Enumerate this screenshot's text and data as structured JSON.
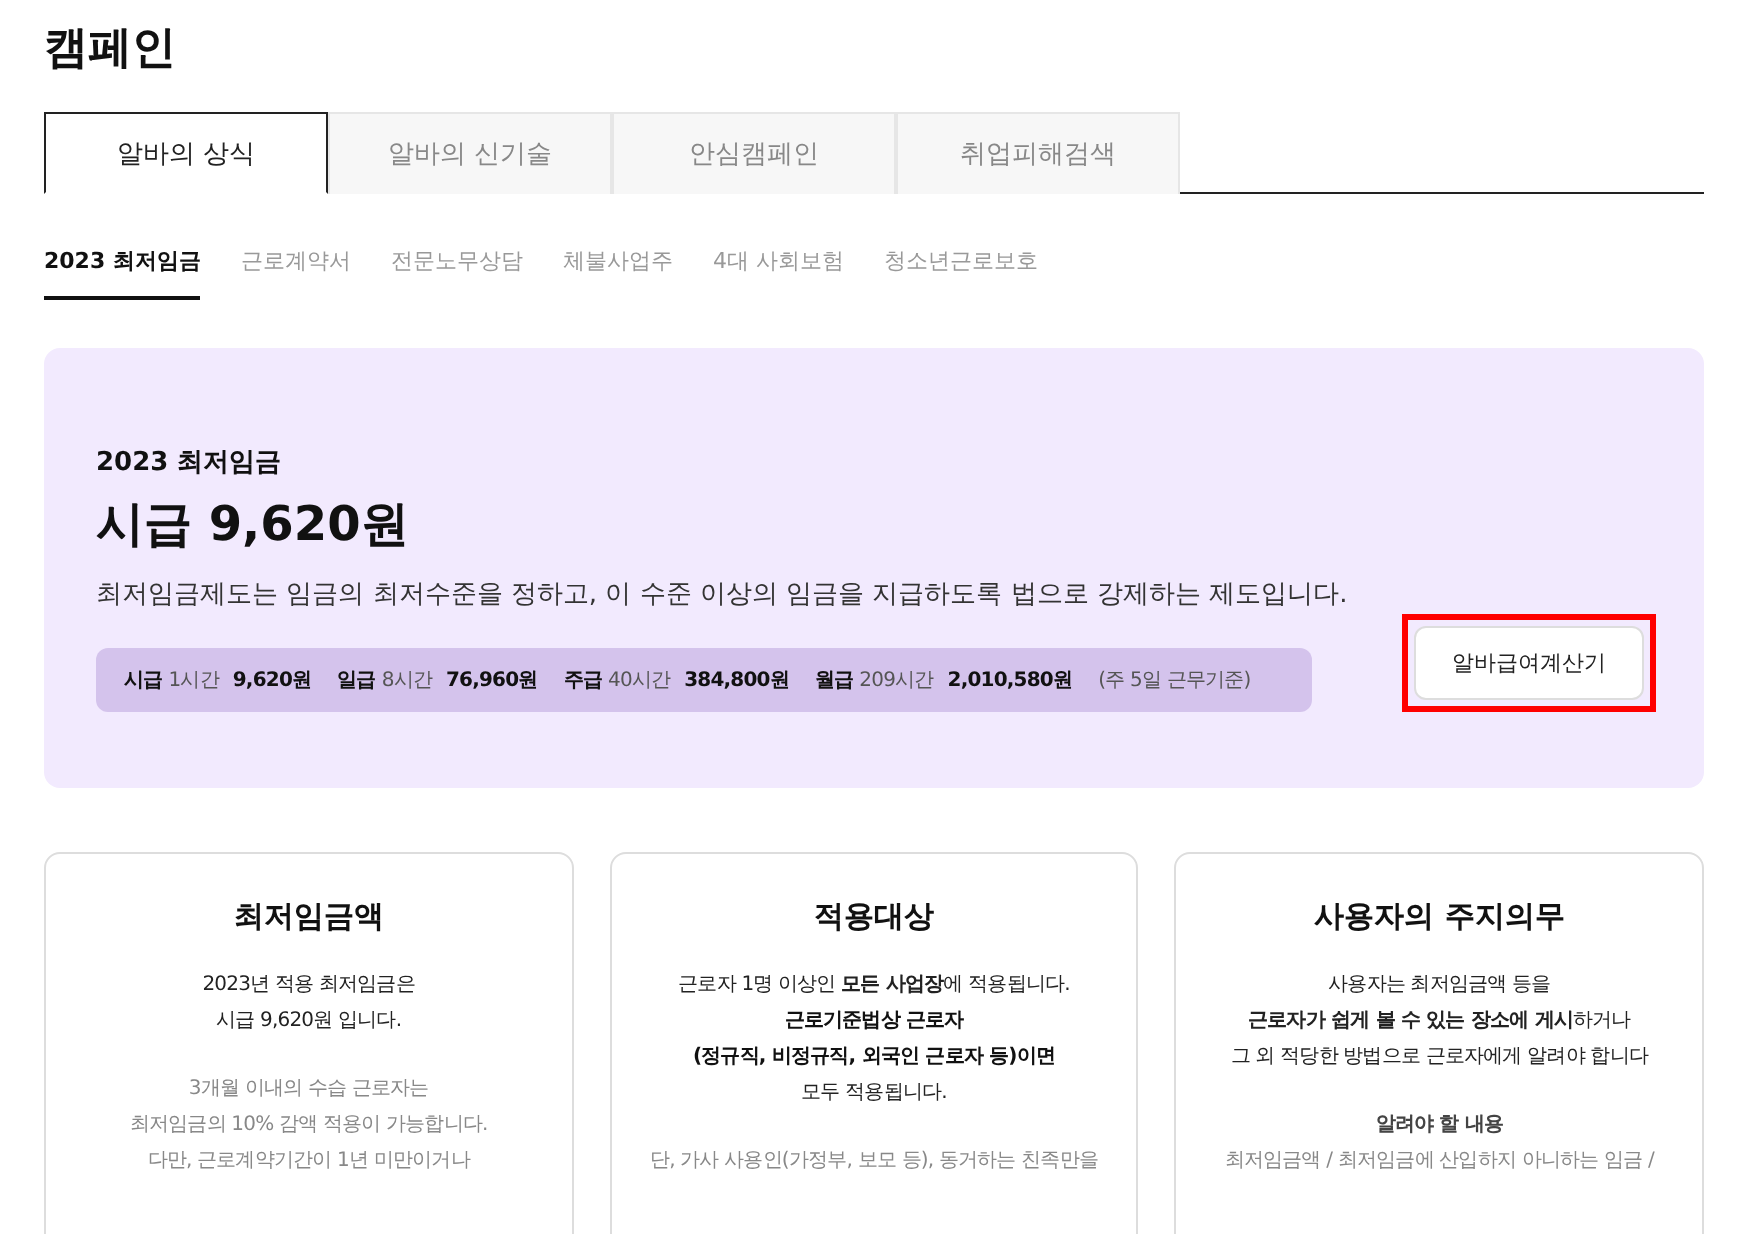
{
  "page_title": "캠페인",
  "tabs": [
    {
      "label": "알바의 상식",
      "selected": true
    },
    {
      "label": "알바의 신기술",
      "selected": false
    },
    {
      "label": "안심캠페인",
      "selected": false
    },
    {
      "label": "취업피해검색",
      "selected": false
    }
  ],
  "subnav": [
    {
      "label": "2023 최저임금",
      "selected": true
    },
    {
      "label": "근로계약서",
      "selected": false
    },
    {
      "label": "전문노무상담",
      "selected": false
    },
    {
      "label": "체불사업주",
      "selected": false
    },
    {
      "label": "4대 사회보험",
      "selected": false
    },
    {
      "label": "청소년근로보호",
      "selected": false
    }
  ],
  "hero": {
    "eyebrow": "2023 최저임금",
    "headline": "시급 9,620원",
    "description": "최저임금제도는 임금의 최저수준을 정하고, 이 수준 이상의 임금을 지급하도록 법으로 강제하는 제도입니다.",
    "wages": [
      {
        "label": "시급",
        "hours": "1시간",
        "amount": "9,620원"
      },
      {
        "label": "일급",
        "hours": "8시간",
        "amount": "76,960원"
      },
      {
        "label": "주급",
        "hours": "40시간",
        "amount": "384,800원"
      },
      {
        "label": "월급",
        "hours": "209시간",
        "amount": "2,010,580원"
      }
    ],
    "note": "(주 5일 근무기준)",
    "button": {
      "label": "알바급여계산기",
      "highlighted": true
    }
  },
  "cards": [
    {
      "title": "최저임금액",
      "blocks": [
        {
          "kind": "normal",
          "lines": [
            "2023년 적용 최저임금은",
            "시급 9,620원 입니다."
          ]
        },
        {
          "kind": "muted",
          "lines": [
            "3개월 이내의 수습 근로자는",
            "최저임금의 10% 감액 적용이 가능합니다.",
            "다만, 근로계약기간이 1년 미만이거나"
          ]
        }
      ]
    },
    {
      "title": "적용대상",
      "blocks": [
        {
          "kind": "normal",
          "lines": [
            "근로자 1명 이상인 **모든 사업장**에 적용됩니다."
          ]
        },
        {
          "kind": "bold",
          "lines": [
            "근로기준법상 근로자",
            "(정규직, 비정규직, 외국인 근로자 등)이면"
          ]
        },
        {
          "kind": "normal",
          "lines": [
            "모두 적용됩니다."
          ]
        },
        {
          "kind": "gap"
        },
        {
          "kind": "muted",
          "lines": [
            "단, 가사 사용인(가정부, 보모 등), 동거하는 친족만을"
          ]
        }
      ]
    },
    {
      "title": "사용자의 주지의무",
      "blocks": [
        {
          "kind": "normal",
          "lines": [
            "사용자는 최저임금액 등을",
            "**근로자가 쉽게 볼 수 있는 장소에 게시**하거나",
            "그 외 적당한 방법으로 근로자에게 알려야 합니다"
          ]
        },
        {
          "kind": "gap"
        },
        {
          "kind": "subhead",
          "lines": [
            "알려야 할 내용"
          ]
        },
        {
          "kind": "muted",
          "lines": [
            "최저임금액 / 최저임금에 산입하지 아니하는 임금 /"
          ]
        }
      ]
    }
  ]
}
